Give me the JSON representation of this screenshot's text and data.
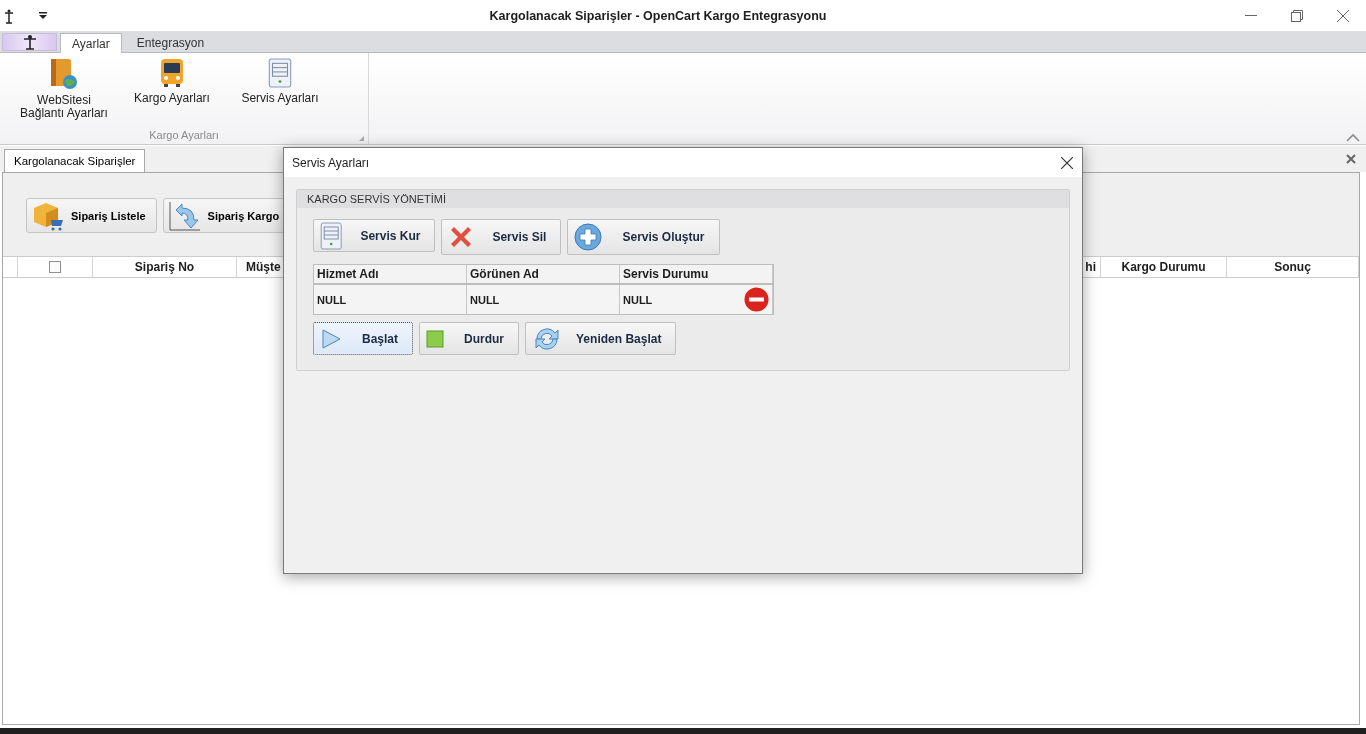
{
  "window": {
    "title": "Kargolanacak Siparişler - OpenCart Kargo Entegrasyonu"
  },
  "ribbon": {
    "tabs": [
      {
        "label": "Ayarlar",
        "selected": true
      },
      {
        "label": "Entegrasyon",
        "selected": false
      }
    ],
    "groups": [
      {
        "label": "Kargo Ayarları",
        "items": [
          {
            "kind": "website",
            "lines": [
              "WebSitesi",
              "Bağlantı Ayarları"
            ]
          },
          {
            "kind": "bus",
            "lines": [
              "Kargo Ayarları"
            ]
          },
          {
            "kind": "server",
            "lines": [
              "Servis Ayarları"
            ]
          }
        ]
      }
    ]
  },
  "document_tabs": [
    {
      "label": "Kargolanacak Siparişler",
      "selected": true
    }
  ],
  "toolbar": [
    {
      "kind": "box",
      "label": "Sipariş Listele"
    },
    {
      "kind": "refresh-arrow",
      "label": "Sipariş Kargo"
    }
  ],
  "grid": {
    "columns_left": [
      "Sipariş No",
      "Müşte"
    ],
    "columns_right": [
      "hi",
      "Kargo Durumu",
      "Sonuç"
    ],
    "select_all_checked": false
  },
  "dialog": {
    "title": "Servis Ayarları",
    "group_title": "KARGO SERVİS YÖNETİMİ",
    "actions": [
      {
        "kind": "server",
        "label": "Servis Kur"
      },
      {
        "kind": "delete",
        "label": "Servis Sil"
      },
      {
        "kind": "add",
        "label": "Servis Oluştur"
      }
    ],
    "table": {
      "columns": [
        "Hizmet Adı",
        "Görünen Ad",
        "Servis Durumu"
      ],
      "rows": [
        {
          "cells": [
            "NULL",
            "NULL",
            "NULL"
          ],
          "stopped": true
        }
      ]
    },
    "controls": [
      {
        "kind": "play",
        "label": "Başlat",
        "focused": true
      },
      {
        "kind": "stop",
        "label": "Durdur",
        "focused": false
      },
      {
        "kind": "restart",
        "label": "Yeniden Başlat",
        "focused": false
      }
    ]
  }
}
